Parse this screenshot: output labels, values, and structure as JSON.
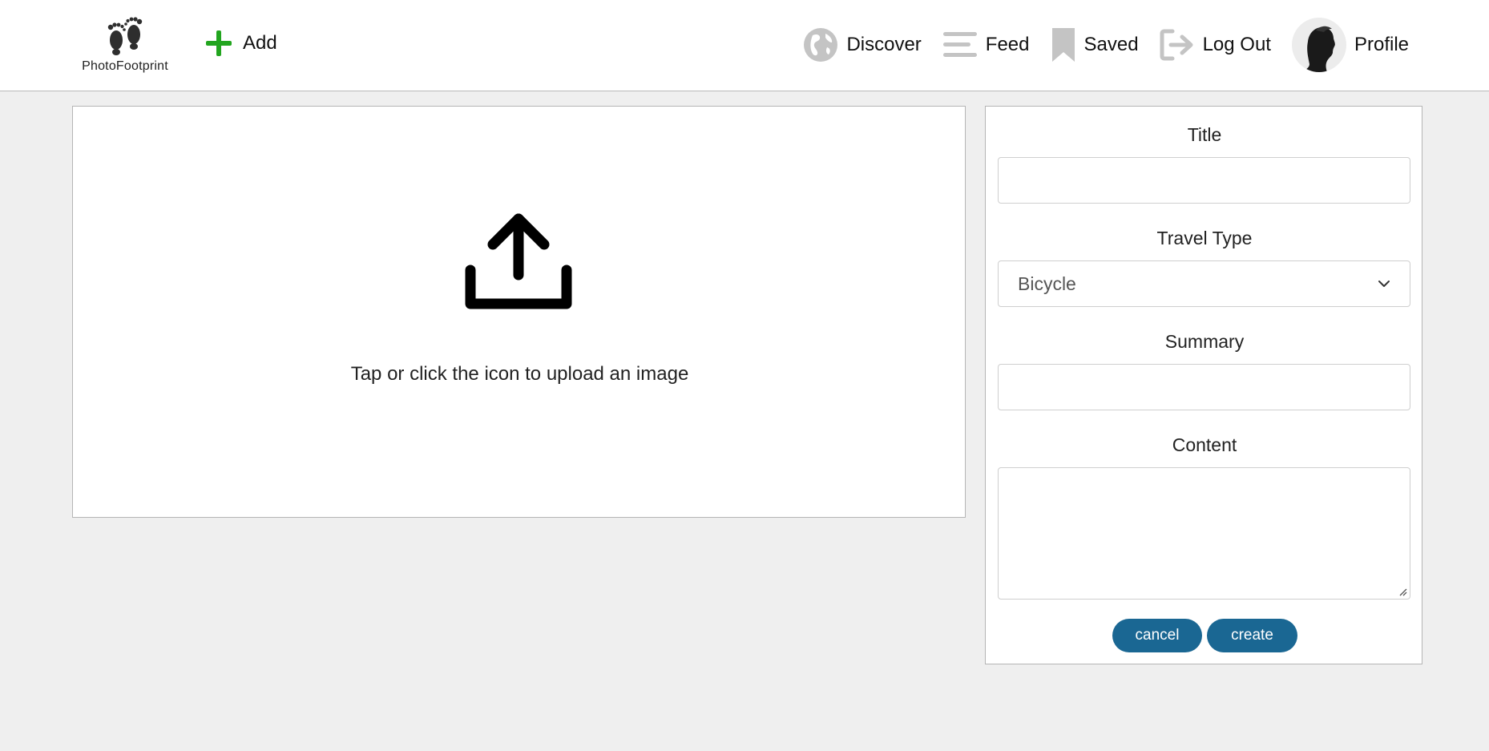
{
  "header": {
    "logo_text": "PhotoFootprint",
    "add_label": "Add",
    "nav": {
      "discover": "Discover",
      "feed": "Feed",
      "saved": "Saved",
      "logout": "Log Out",
      "profile": "Profile"
    }
  },
  "upload": {
    "instruction": "Tap or click the icon to upload an image"
  },
  "form": {
    "title_label": "Title",
    "title_value": "",
    "travel_type_label": "Travel Type",
    "travel_type_value": "Bicycle",
    "summary_label": "Summary",
    "summary_value": "",
    "content_label": "Content",
    "content_value": "",
    "cancel_label": "cancel",
    "create_label": "create"
  },
  "colors": {
    "add_icon": "#22a51f",
    "nav_icon_gray": "#c4c4c4",
    "button_blue": "#1a6793",
    "page_bg": "#efefef"
  },
  "icons": {
    "logo": "footprints-icon",
    "add": "plus-icon",
    "discover": "globe-icon",
    "feed": "menu-lines-icon",
    "saved": "bookmark-icon",
    "logout": "logout-arrow-icon",
    "upload": "upload-icon",
    "select": "chevron-down-icon"
  }
}
